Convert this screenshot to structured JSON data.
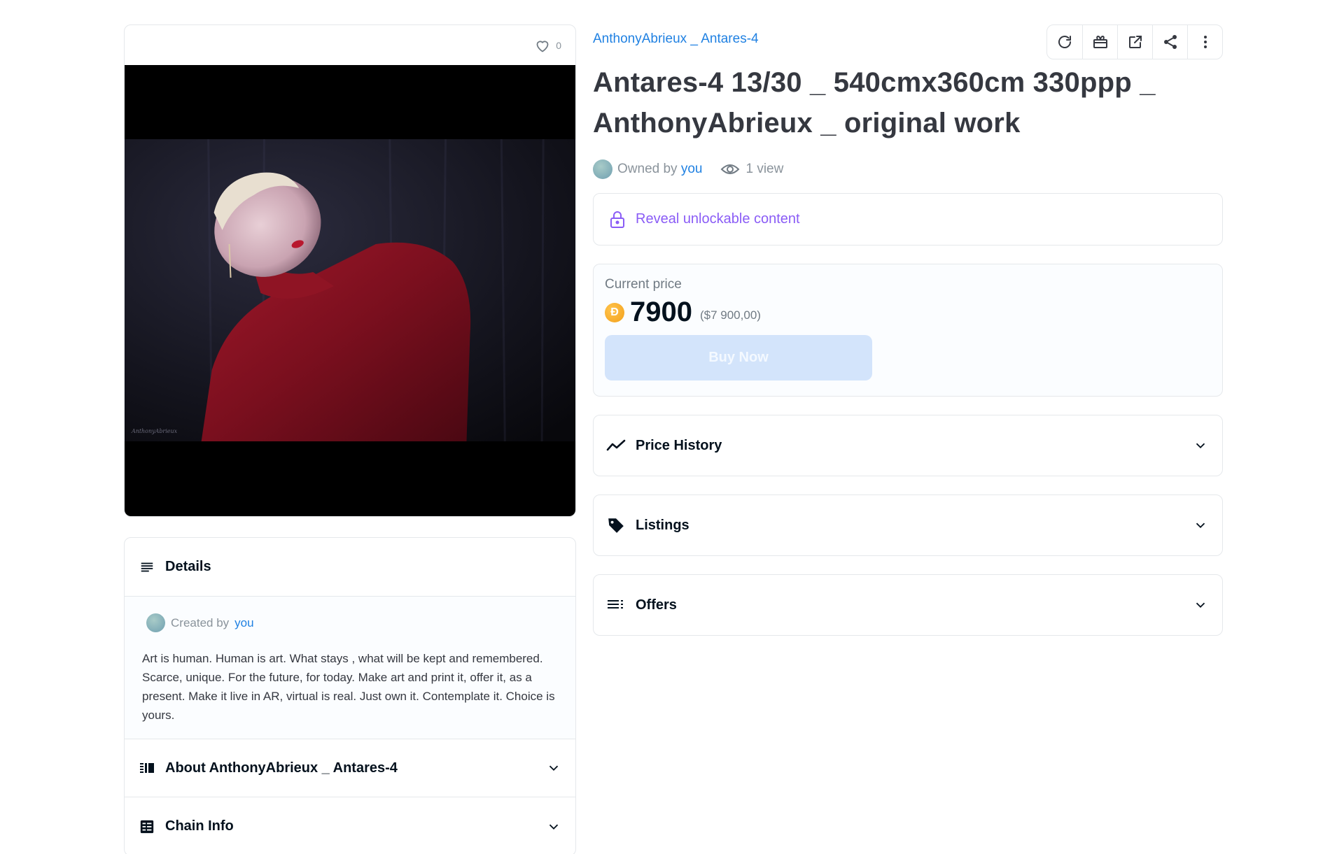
{
  "media": {
    "favorite_count": "0",
    "watermark": "AnthonyAbrieux"
  },
  "details": {
    "title": "Details",
    "created_by_label": "Created by",
    "created_by_user": "you",
    "description": "Art is human. Human is art. What stays , what will be kept and remembered. Scarce, unique. For the future, for today. Make art and print it, offer it, as a present. Make it live in AR, virtual is real. Just own it. Contemplate it. Choice is yours.",
    "about_label": "About AnthonyAbrieux _ Antares-4",
    "chain_info_label": "Chain Info"
  },
  "item": {
    "collection": "AnthonyAbrieux _ Antares-4",
    "title": "Antares-4 13/30 _ 540cmx360cm 330ppp _ AnthonyAbrieux _ original work",
    "owned_by_label": "Owned by",
    "owner": "you",
    "views": "1 view",
    "unlockable_label": "Reveal unlockable content"
  },
  "toolbar": {
    "icons": [
      "refresh-icon",
      "gift-icon",
      "external-link-icon",
      "share-icon",
      "more-icon"
    ]
  },
  "price": {
    "label": "Current price",
    "value": "7900",
    "usd": "($7 900,00)",
    "currency_icon": "coin-icon",
    "buy_label": "Buy Now"
  },
  "sections": {
    "price_history": "Price History",
    "listings": "Listings",
    "offers": "Offers"
  },
  "colors": {
    "link": "#2081e2",
    "unlock": "#8a5cf6",
    "buy_button_disabled": "#d3e4fb",
    "coin": "#f3a01a"
  }
}
